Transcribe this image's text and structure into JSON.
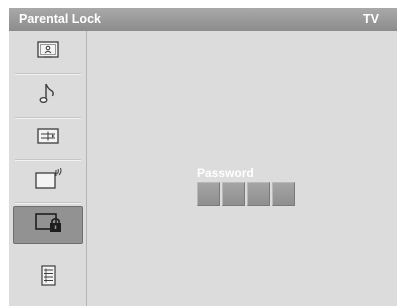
{
  "header": {
    "title": "Parental Lock",
    "source": "TV"
  },
  "sidebar": {
    "items": [
      {
        "icon": "picture-icon",
        "name": "sidebar-item-picture",
        "selected": false
      },
      {
        "icon": "music-note-icon",
        "name": "sidebar-item-sound",
        "selected": false
      },
      {
        "icon": "channel-list-icon",
        "name": "sidebar-item-channel",
        "selected": false
      },
      {
        "icon": "antenna-setup-icon",
        "name": "sidebar-item-setup",
        "selected": false
      },
      {
        "icon": "lock-icon",
        "name": "sidebar-item-parental-lock",
        "selected": true
      },
      {
        "icon": "menu-list-icon",
        "name": "sidebar-item-other",
        "selected": false
      }
    ]
  },
  "password": {
    "label": "Password",
    "digits": [
      "",
      "",
      "",
      ""
    ]
  },
  "colors": {
    "background": "#dcdcdc",
    "header": "#9a9a9a",
    "selected": "#929292",
    "box": "#9a9a9a",
    "text": "#ffffff"
  }
}
